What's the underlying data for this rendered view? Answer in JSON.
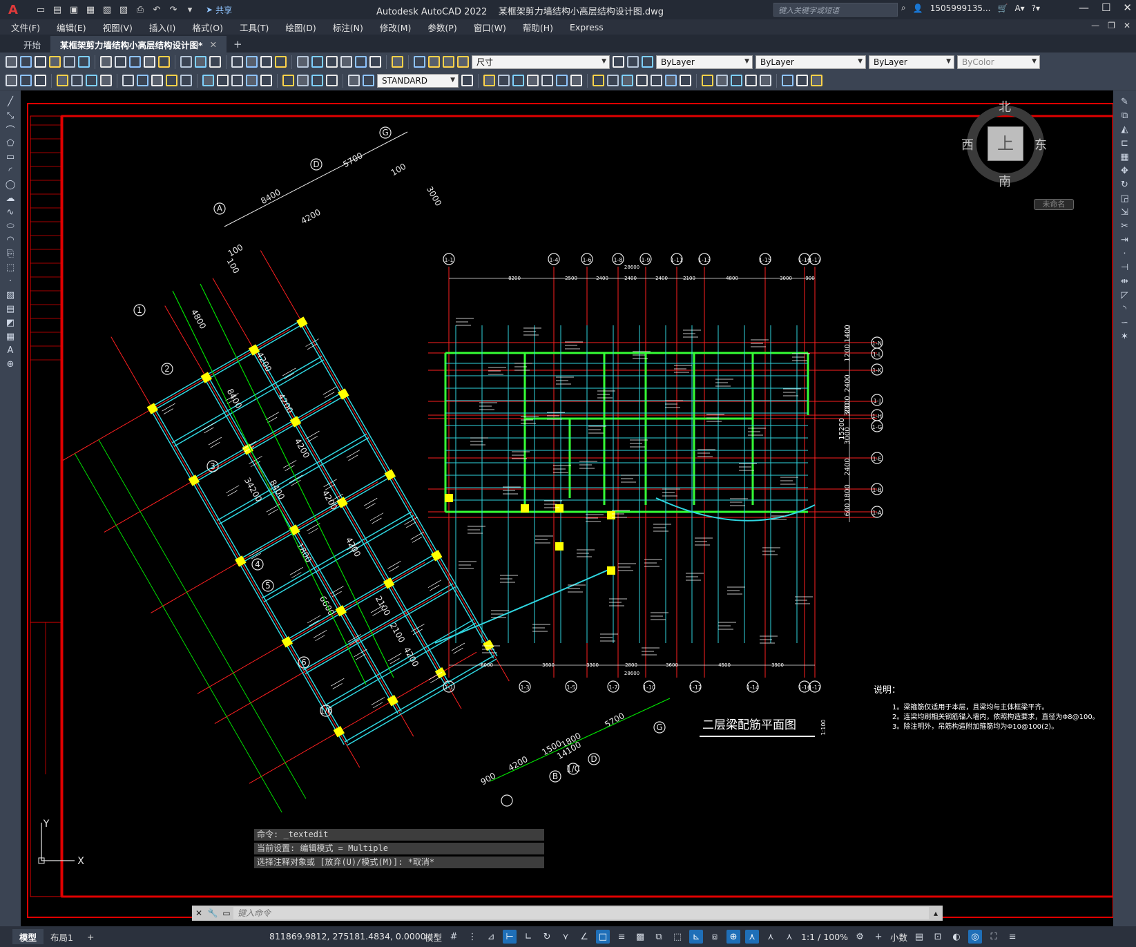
{
  "titlebar": {
    "app_name": "Autodesk AutoCAD 2022",
    "file_name": "某框架剪力墙结构小高层结构设计图.dwg",
    "share_label": "共享",
    "search_placeholder": "键入关键字或短语",
    "user": "1505999135..."
  },
  "menu": [
    "文件(F)",
    "编辑(E)",
    "视图(V)",
    "插入(I)",
    "格式(O)",
    "工具(T)",
    "绘图(D)",
    "标注(N)",
    "修改(M)",
    "参数(P)",
    "窗口(W)",
    "帮助(H)",
    "Express"
  ],
  "tabs": [
    {
      "label": "开始"
    },
    {
      "label": "某框架剪力墙结构小高层结构设计图*"
    }
  ],
  "toolbar_props": {
    "layer": "尺寸",
    "color": "ByLayer",
    "linetype": "ByLayer",
    "lineweight": "ByLayer",
    "plotstyle": "ByColor",
    "textstyle": "STANDARD"
  },
  "viewcube": {
    "north": "北",
    "south": "南",
    "east": "东",
    "west": "西",
    "top": "上",
    "wcs": "未命名"
  },
  "drawing": {
    "title": "二层梁配筋平面图",
    "title_scale": "1:100",
    "notes_heading": "说明：",
    "notes": [
      "1。梁箍筋仅适用于本层，且梁均与主体框梁平齐。",
      "2。连梁均刷相关钢筋锚入墙内，依照构造要求，直径为Φ8@100。",
      "3。除注明外，吊筋构造附加箍筋均为Φ10@100(2)。"
    ],
    "axis_labels_left": [
      "A",
      "D",
      "G",
      "1",
      "2",
      "3",
      "4",
      "5",
      "6",
      "1/6"
    ],
    "axis_labels_top": [
      "1-1",
      "1-4",
      "1-6",
      "1-8",
      "1-9",
      "1-11",
      "1-13",
      "1-15",
      "1-16",
      "1-17"
    ],
    "axis_labels_bottom": [
      "1-1",
      "1-3",
      "1-5",
      "1-7",
      "1-10",
      "1-12",
      "1-14",
      "1-16",
      "1-17"
    ],
    "axis_labels_right": [
      "1-N",
      "1-L",
      "1-K",
      "1-J",
      "1-H",
      "1-G",
      "1-E",
      "1-B",
      "1-A"
    ],
    "axis_labels_lower": [
      "B",
      "1/C",
      "D",
      "G"
    ],
    "dims_top": [
      "28600",
      "8200",
      "2500",
      "2400",
      "2400",
      "2400",
      "2100",
      "4800",
      "3000",
      "900"
    ],
    "dims_bottom": [
      "28600",
      "6000",
      "3600",
      "3300",
      "2800",
      "3600",
      "4500",
      "3900"
    ],
    "dims_right": [
      "1400",
      "1200",
      "2400",
      "2100",
      "300",
      "3000",
      "2400",
      "1800",
      "600",
      "15200"
    ],
    "dims_left": [
      "4800",
      "8400",
      "8400",
      "1800",
      "6600",
      "34200",
      "4200",
      "4200",
      "4200",
      "4200",
      "4200",
      "2100",
      "2100",
      "4200"
    ],
    "dims_upper": [
      "8400",
      "5700",
      "4200",
      "100",
      "3000",
      "100",
      "100"
    ],
    "dims_lower": [
      "900",
      "4200",
      "1500",
      "1800",
      "14100",
      "5700"
    ],
    "ucs_y": "Y",
    "ucs_x": "X"
  },
  "command": {
    "history": [
      "命令: _textedit",
      "当前设置: 编辑模式 = Multiple",
      "选择注释对象或 [放弃(U)/模式(M)]: *取消*"
    ],
    "placeholder": "键入命令"
  },
  "status": {
    "model_tab": "模型",
    "layout_tab": "布局1",
    "coords": "811869.9812, 275181.4834, 0.0000",
    "space": "模型",
    "scale": "1:1 / 100%",
    "units": "小数"
  },
  "colors": {
    "frame_red": "#e00000",
    "beam_cyan": "#2fd6e0",
    "wall_green": "#35ff35",
    "column_yellow": "#ffff00",
    "axis_red": "#ff2020",
    "dim_green": "#00e000",
    "text_white": "#ffffff"
  }
}
